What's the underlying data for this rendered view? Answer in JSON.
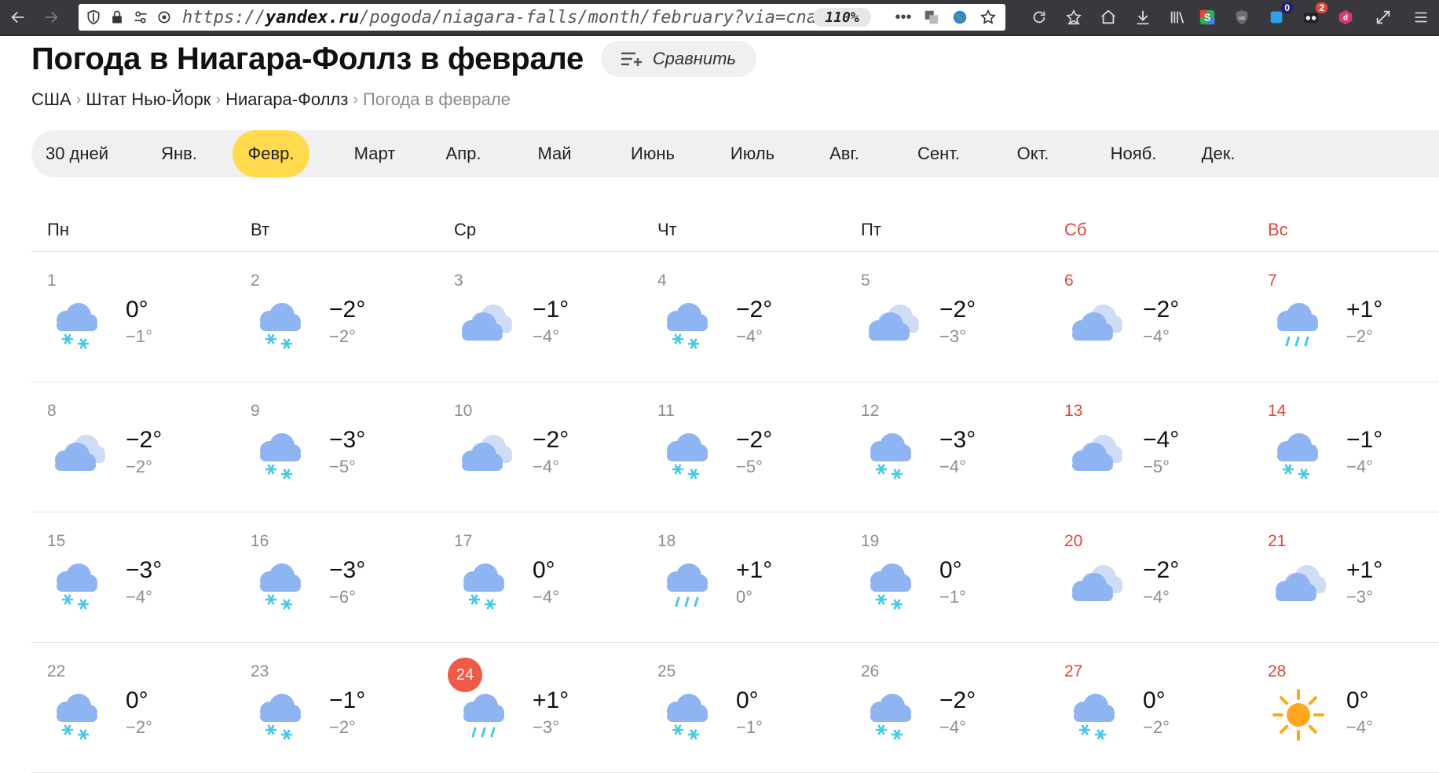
{
  "browser": {
    "url_prefix": "https://",
    "url_domain": "yandex.ru",
    "url_path": "/pogoda/niagara-falls/month/february?via=cnav",
    "zoom": "110%",
    "badge_counts": [
      "0",
      "2"
    ]
  },
  "header": {
    "title": "Погода в Ниагара-Фоллз в феврале",
    "compare_label": "Сравнить"
  },
  "breadcrumb": {
    "items": [
      "США",
      "Штат Нью-Йорк",
      "Ниагара-Фоллз"
    ],
    "current": "Погода в феврале",
    "separator": "›"
  },
  "months": {
    "items": [
      "30 дней",
      "Янв.",
      "Февр.",
      "Март",
      "Апр.",
      "Май",
      "Июнь",
      "Июль",
      "Авг.",
      "Сент.",
      "Окт.",
      "Нояб.",
      "Дек."
    ],
    "active_index": 2
  },
  "calendar": {
    "weekdays": [
      "Пн",
      "Вт",
      "Ср",
      "Чт",
      "Пт",
      "Сб",
      "Вс"
    ],
    "weeks": [
      [
        {
          "day": "1",
          "icon": "cloud-snow-icon",
          "high": "0°",
          "low": "−1°"
        },
        {
          "day": "2",
          "icon": "cloud-snow-icon",
          "high": "−2°",
          "low": "−2°"
        },
        {
          "day": "3",
          "icon": "overcast-icon",
          "high": "−1°",
          "low": "−4°"
        },
        {
          "day": "4",
          "icon": "cloud-snow-icon",
          "high": "−2°",
          "low": "−4°"
        },
        {
          "day": "5",
          "icon": "overcast-icon",
          "high": "−2°",
          "low": "−3°"
        },
        {
          "day": "6",
          "icon": "overcast-icon",
          "high": "−2°",
          "low": "−4°"
        },
        {
          "day": "7",
          "icon": "cloud-rain-icon",
          "high": "+1°",
          "low": "−2°"
        }
      ],
      [
        {
          "day": "8",
          "icon": "overcast-icon",
          "high": "−2°",
          "low": "−2°"
        },
        {
          "day": "9",
          "icon": "cloud-snow-icon",
          "high": "−3°",
          "low": "−5°"
        },
        {
          "day": "10",
          "icon": "overcast-icon",
          "high": "−2°",
          "low": "−4°"
        },
        {
          "day": "11",
          "icon": "cloud-snow-icon",
          "high": "−2°",
          "low": "−5°"
        },
        {
          "day": "12",
          "icon": "cloud-snow-icon",
          "high": "−3°",
          "low": "−4°"
        },
        {
          "day": "13",
          "icon": "overcast-icon",
          "high": "−4°",
          "low": "−5°"
        },
        {
          "day": "14",
          "icon": "cloud-snow-icon",
          "high": "−1°",
          "low": "−4°"
        }
      ],
      [
        {
          "day": "15",
          "icon": "cloud-snow-icon",
          "high": "−3°",
          "low": "−4°"
        },
        {
          "day": "16",
          "icon": "cloud-snow-icon",
          "high": "−3°",
          "low": "−6°"
        },
        {
          "day": "17",
          "icon": "cloud-snow-icon",
          "high": "0°",
          "low": "−4°"
        },
        {
          "day": "18",
          "icon": "cloud-rain-icon",
          "high": "+1°",
          "low": "0°"
        },
        {
          "day": "19",
          "icon": "cloud-snow-icon",
          "high": "0°",
          "low": "−1°"
        },
        {
          "day": "20",
          "icon": "overcast-icon",
          "high": "−2°",
          "low": "−4°"
        },
        {
          "day": "21",
          "icon": "overcast-icon",
          "high": "+1°",
          "low": "−3°"
        }
      ],
      [
        {
          "day": "22",
          "icon": "cloud-snow-icon",
          "high": "0°",
          "low": "−2°"
        },
        {
          "day": "23",
          "icon": "cloud-snow-icon",
          "high": "−1°",
          "low": "−2°"
        },
        {
          "day": "24",
          "icon": "cloud-rain-icon",
          "high": "+1°",
          "low": "−3°",
          "today": true
        },
        {
          "day": "25",
          "icon": "cloud-snow-icon",
          "high": "0°",
          "low": "−1°"
        },
        {
          "day": "26",
          "icon": "cloud-snow-icon",
          "high": "−2°",
          "low": "−4°"
        },
        {
          "day": "27",
          "icon": "cloud-snow-icon",
          "high": "0°",
          "low": "−2°"
        },
        {
          "day": "28",
          "icon": "sun-icon",
          "high": "0°",
          "low": "−4°"
        }
      ]
    ]
  },
  "colors": {
    "accent_yellow": "#ffdb4d",
    "weekend_red": "#e0463a",
    "today_badge": "#ee5a46",
    "cloud_blue": "#8fb4f2",
    "snow_cyan": "#46c8e8",
    "sun_orange": "#ffa81f"
  }
}
